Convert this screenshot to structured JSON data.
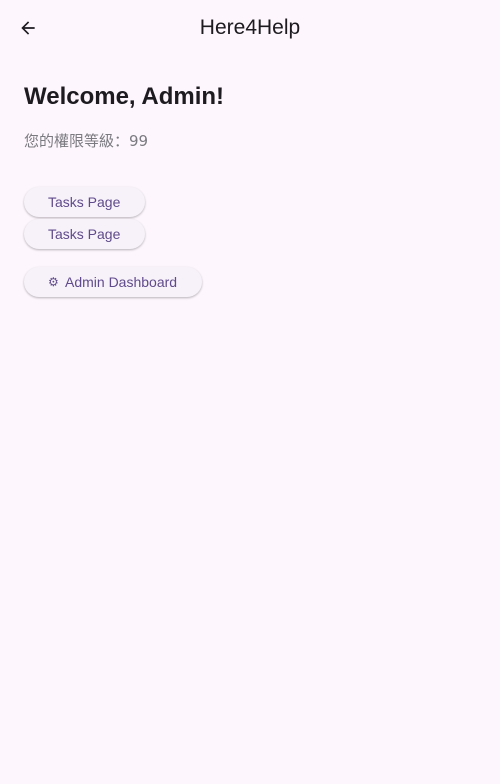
{
  "app_bar": {
    "title": "Here4Help",
    "back_icon": "arrow-back-icon"
  },
  "main": {
    "welcome": "Welcome, Admin!",
    "permission_text": "您的權限等級：99"
  },
  "buttons": {
    "tasks_1": "Tasks Page",
    "tasks_2": "Tasks Page",
    "admin_dashboard": "Admin Dashboard",
    "admin_icon": "gear-icon"
  },
  "colors": {
    "background": "#fdf7fd",
    "button_bg": "#f7f1f9",
    "button_text": "#5f4b8b",
    "muted_text": "#7a7a80"
  }
}
